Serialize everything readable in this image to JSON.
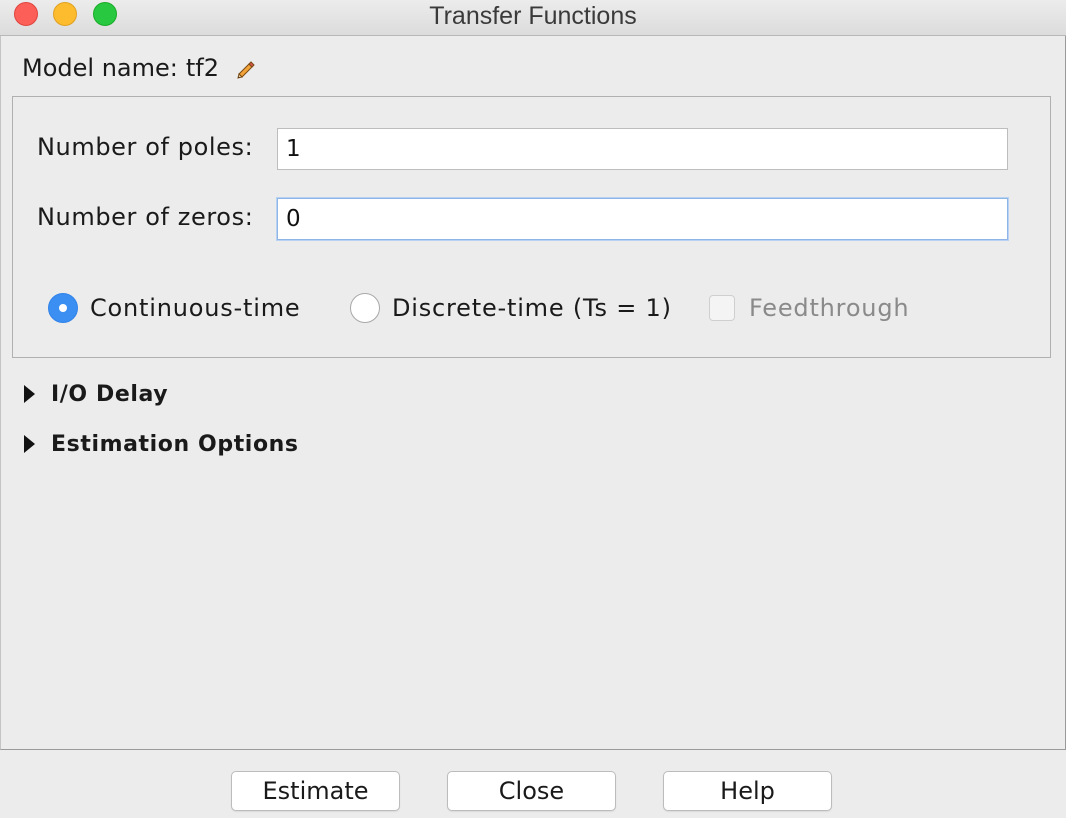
{
  "window": {
    "title": "Transfer Functions"
  },
  "model": {
    "label": "Model name:",
    "name": "tf2",
    "edit_icon": "pencil-icon"
  },
  "fields": {
    "poles": {
      "label": "Number of poles:",
      "value": "1"
    },
    "zeros": {
      "label": "Number of zeros:",
      "value": "0"
    }
  },
  "options": {
    "continuous": {
      "label": "Continuous-time",
      "selected": true
    },
    "discrete": {
      "label": "Discrete-time (Ts = 1)",
      "selected": false
    },
    "feedthrough": {
      "label": "Feedthrough",
      "checked": false,
      "enabled": false
    }
  },
  "sections": [
    {
      "label": "I/O Delay",
      "expanded": false
    },
    {
      "label": "Estimation Options",
      "expanded": false
    }
  ],
  "buttons": {
    "estimate": "Estimate",
    "close": "Close",
    "help": "Help"
  },
  "colors": {
    "accent": "#3b8ff3",
    "window_bg": "#ececec"
  }
}
